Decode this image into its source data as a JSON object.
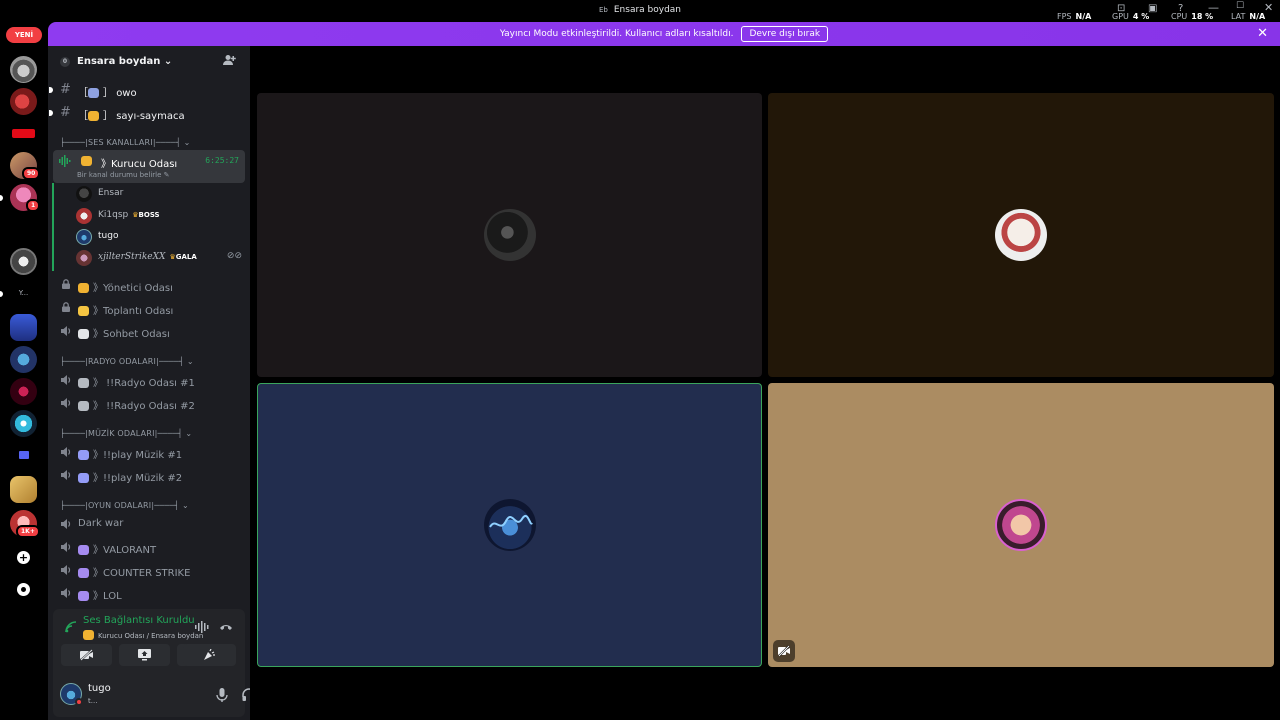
{
  "titlebar": {
    "title": "Ensara boydan",
    "app_badge": "Eb",
    "stats": {
      "fps_label": "FPS",
      "fps_value": "N/A",
      "gpu_label": "GPU",
      "gpu_value": "4 %",
      "cpu_label": "CPU",
      "cpu_value": "18 %",
      "lat_label": "LAT",
      "lat_value": "N/A"
    },
    "controls": {
      "minimize": "—",
      "maximize": "☐",
      "close": "✕"
    }
  },
  "banner": {
    "text": "Yayıncı Modu etkinleştirildi. Kullanıcı adları kısaltıldı.",
    "button": "Devre dışı bırak",
    "close": "✕"
  },
  "guilds": {
    "new_badge": "YENİ",
    "badges": [
      "90",
      "1",
      "1K+"
    ],
    "text_server": "Y..."
  },
  "server": {
    "name": "Ensara boydan ⌄",
    "icon_letter": "0",
    "invite_icon": "person-add-icon"
  },
  "text_channels": [
    {
      "name": "owo",
      "prefix": "［",
      "suffix": "］"
    },
    {
      "name": "sayı-saymaca",
      "prefix": "［",
      "suffix": "］"
    }
  ],
  "categories": {
    "voice": "├────|SES KANALLARI|────┤ ⌄",
    "radio": "├────|RADYO ODALARI|────┤ ⌄",
    "music": "├────|MÜZİK ODALARI|────┤ ⌄",
    "game": "├────|OYUN ODALARI|────┤ ⌄"
  },
  "active_channel": {
    "name": "》Kurucu Odası",
    "timer": "6:25:27",
    "status": "Bir kanal durumu belirle ✎"
  },
  "voice_users": [
    {
      "name": "Ensar",
      "tag": ""
    },
    {
      "name": "Ki1qsp",
      "tag": "BOSS"
    },
    {
      "name": "tugo",
      "tag": ""
    },
    {
      "name": "xjilterStrikeXX",
      "tag": "GALA"
    }
  ],
  "voice_channels_1": [
    {
      "name": "》Yönetici Odası",
      "locked": true
    },
    {
      "name": "》Toplantı Odası",
      "locked": true
    },
    {
      "name": "》Sohbet Odası",
      "locked": false
    }
  ],
  "radio_channels": [
    "》 !!Radyo Odası #1",
    "》 !!Radyo Odası #2"
  ],
  "music_channels": [
    "》!!play Müzik #1",
    "》!!play Müzik #2"
  ],
  "game_channels": [
    "Dark war",
    "》VALORANT",
    "》COUNTER STRIKE",
    "》LOL"
  ],
  "voice_panel": {
    "status": "Ses Bağlantısı Kuruldu",
    "location": "Kurucu Odası / Ensara boydan"
  },
  "user_panel": {
    "name": "tugo",
    "status": "t..."
  },
  "colors": {
    "accent_purple": "#8a3ff0",
    "connected_green": "#23a55a",
    "tile_1": "#1b1719",
    "tile_2": "#221708",
    "tile_3": "#222d4e",
    "tile_4": "#ab8c62"
  }
}
